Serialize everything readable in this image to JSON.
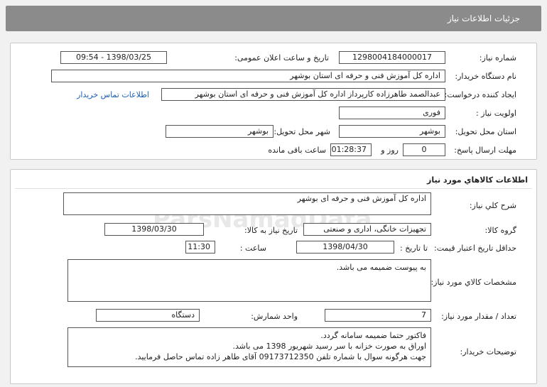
{
  "header": {
    "title": "جزئیات اطلاعات نیاز"
  },
  "need_info": {
    "need_number_label": "شماره نیاز:",
    "need_number": "1298004184000017",
    "announce_label": "تاریخ و ساعت اعلان عمومی:",
    "announce_value": "1398/03/25 - 09:54",
    "buyer_org_label": "نام دستگاه خریدار:",
    "buyer_org": "اداره کل آموزش فنی و حرفه ای استان بوشهر",
    "requester_label": "ایجاد کننده درخواست:",
    "requester": "عبدالصمد طاهرزاده کارپرداز اداره کل آموزش فنی و حرفه ای استان بوشهر",
    "contact_link": "اطلاعات تماس خریدار",
    "priority_label": "اولویت نیاز :",
    "priority": "فوری",
    "delivery_province_label": "استان محل تحویل:",
    "delivery_province": "بوشهر",
    "delivery_city_label": "شهر محل تحویل:",
    "delivery_city": "بوشهر",
    "deadline_label": "مهلت ارسال پاسخ:",
    "days_value": "0",
    "days_label": "روز و",
    "time_value": "01:28:37",
    "remaining_label": "ساعت باقی مانده"
  },
  "goods": {
    "section_title": "اطلاعات کالاهاي مورد نياز",
    "general_desc_label": "شرح کلي نياز:",
    "general_desc": "اداره کل آموزش فنی و حرفه ای بوشهر",
    "group_label": "گروه کالا:",
    "group": "تجهیزات خانگی، اداری و صنعتی",
    "need_date_label": "تاریخ نیاز به کالا:",
    "need_date": "1398/03/30",
    "validity_label": "حداقل تاریخ اعتبار قیمت:",
    "until_date_label": "تا تاریخ :",
    "until_date": "1398/04/30",
    "hour_label": "ساعت :",
    "hour": "11:30",
    "specs_label": "مشخصات کالاي مورد نياز:",
    "specs": "به پیوست ضمیمه می باشد.",
    "qty_label": "تعداد / مقدار مورد نیاز:",
    "qty": "7",
    "unit_label": "واحد شمارش:",
    "unit": "دستگاه",
    "buyer_notes_label": "توضیحات خریدار:",
    "buyer_notes": [
      "فاکتور حتما ضمیمه سامانه گردد.",
      "اوراق به صورت خزانه با سر رسید شهریور 1398 می باشد.",
      "جهت هرگونه سوال با شماره تلفن 09173712350 آقای طاهر زاده تماس حاصل فرمایید."
    ]
  }
}
